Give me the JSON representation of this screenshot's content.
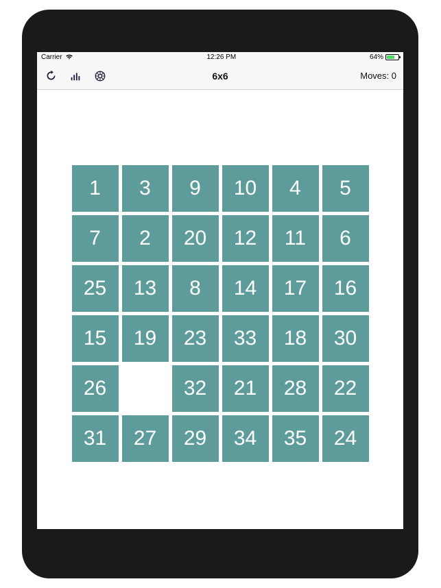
{
  "status": {
    "carrier": "Carrier",
    "time": "12:26 PM",
    "battery_pct": "64%"
  },
  "nav": {
    "title": "6x6",
    "moves_label": "Moves: 0"
  },
  "grid": {
    "cols": 6,
    "tiles": [
      "1",
      "3",
      "9",
      "10",
      "4",
      "5",
      "7",
      "2",
      "20",
      "12",
      "11",
      "6",
      "25",
      "13",
      "8",
      "14",
      "17",
      "16",
      "15",
      "19",
      "23",
      "33",
      "18",
      "30",
      "26",
      "",
      "32",
      "21",
      "28",
      "22",
      "31",
      "27",
      "29",
      "34",
      "35",
      "24"
    ]
  },
  "colors": {
    "tile": "#5e9b9b",
    "frame": "#1a1a1a"
  }
}
